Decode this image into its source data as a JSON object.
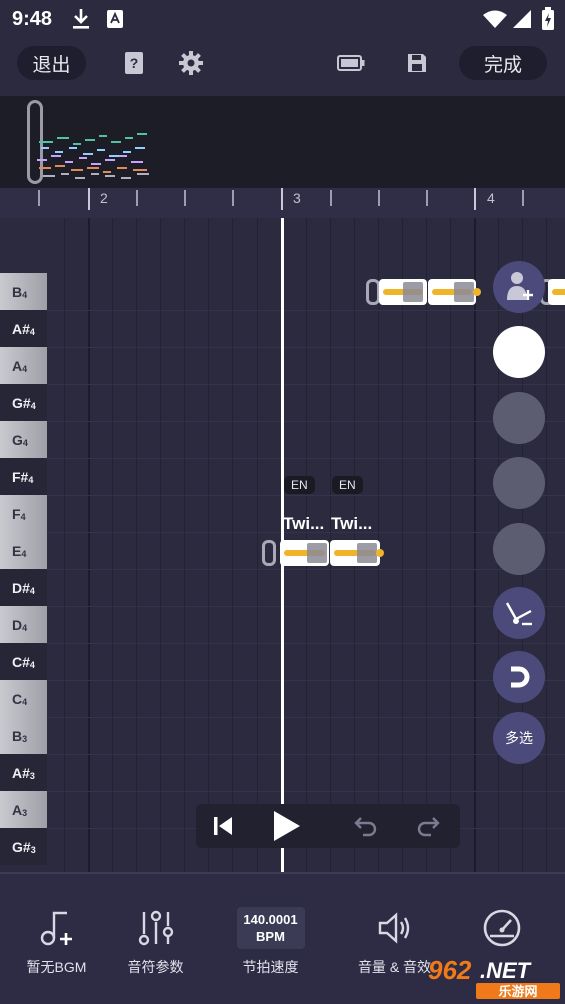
{
  "status_bar": {
    "time": "9:48"
  },
  "toolbar": {
    "exit_label": "退出",
    "done_label": "完成"
  },
  "ruler": {
    "bars": [
      "2",
      "3",
      "4"
    ]
  },
  "piano_keys": [
    {
      "note": "B",
      "octave": "4",
      "type": "white"
    },
    {
      "note": "A#",
      "octave": "4",
      "type": "black"
    },
    {
      "note": "A",
      "octave": "4",
      "type": "white"
    },
    {
      "note": "G#",
      "octave": "4",
      "type": "black"
    },
    {
      "note": "G",
      "octave": "4",
      "type": "white"
    },
    {
      "note": "F#",
      "octave": "4",
      "type": "black"
    },
    {
      "note": "F",
      "octave": "4",
      "type": "white"
    },
    {
      "note": "E",
      "octave": "4",
      "type": "white"
    },
    {
      "note": "D#",
      "octave": "4",
      "type": "black"
    },
    {
      "note": "D",
      "octave": "4",
      "type": "white"
    },
    {
      "note": "C#",
      "octave": "4",
      "type": "black"
    },
    {
      "note": "C",
      "octave": "4",
      "type": "white"
    },
    {
      "note": "B",
      "octave": "3",
      "type": "white"
    },
    {
      "note": "A#",
      "octave": "3",
      "type": "black"
    },
    {
      "note": "A",
      "octave": "3",
      "type": "white"
    },
    {
      "note": "G#",
      "octave": "3",
      "type": "black"
    }
  ],
  "notes": [
    {
      "lang": "EN",
      "lyric": "Twi..."
    },
    {
      "lang": "EN",
      "lyric": "Twi..."
    }
  ],
  "side_tools": {
    "multi_select_label": "多选"
  },
  "bottom_bar": {
    "bgm_label": "暂无BGM",
    "note_params_label": "音符参数",
    "bpm_value": "140.0001",
    "bpm_unit": "BPM",
    "tempo_label": "节拍速度",
    "volume_label": "音量 & 音效"
  },
  "watermark": {
    "text": "962.NET",
    "sub": "乐游网"
  },
  "colors": {
    "background": "#2b2a3f",
    "note_fill": "#ffffff",
    "note_bar": "#f0b429",
    "playhead": "#ffffff"
  }
}
